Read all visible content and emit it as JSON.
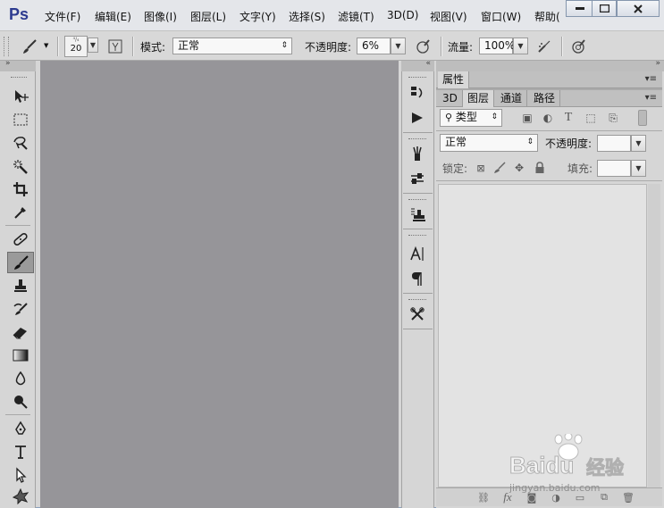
{
  "app": {
    "logo": "Ps"
  },
  "menu": [
    "文件(F)",
    "编辑(E)",
    "图像(I)",
    "图层(L)",
    "文字(Y)",
    "选择(S)",
    "滤镜(T)",
    "3D(D)",
    "视图(V)",
    "窗口(W)",
    "帮助("
  ],
  "options": {
    "brush_size": "20",
    "mode_label": "模式:",
    "mode_value": "正常",
    "opacity_label": "不透明度:",
    "opacity_value": "6%",
    "flow_label": "流量:",
    "flow_value": "100%"
  },
  "tools": [
    "move-icon",
    "marquee-icon",
    "lasso-icon",
    "magic-wand-icon",
    "crop-icon",
    "eyedropper-icon",
    "healing-brush-icon",
    "brush-icon",
    "clone-stamp-icon",
    "history-brush-icon",
    "eraser-icon",
    "gradient-icon",
    "blur-icon",
    "dodge-icon",
    "pen-icon",
    "type-icon",
    "path-selection-icon",
    "shape-icon"
  ],
  "panels": {
    "properties_tab": "属性",
    "tabs": [
      "3D",
      "图层",
      "通道",
      "路径"
    ],
    "active_tab": "图层",
    "filter_label": "类型",
    "blend_value": "正常",
    "opacity_label": "不透明度:",
    "lock_label": "锁定:",
    "fill_label": "填充:"
  },
  "watermark": {
    "brand": "Baidu",
    "brand_cn": "经验",
    "url": "jingyan.baidu.com"
  }
}
